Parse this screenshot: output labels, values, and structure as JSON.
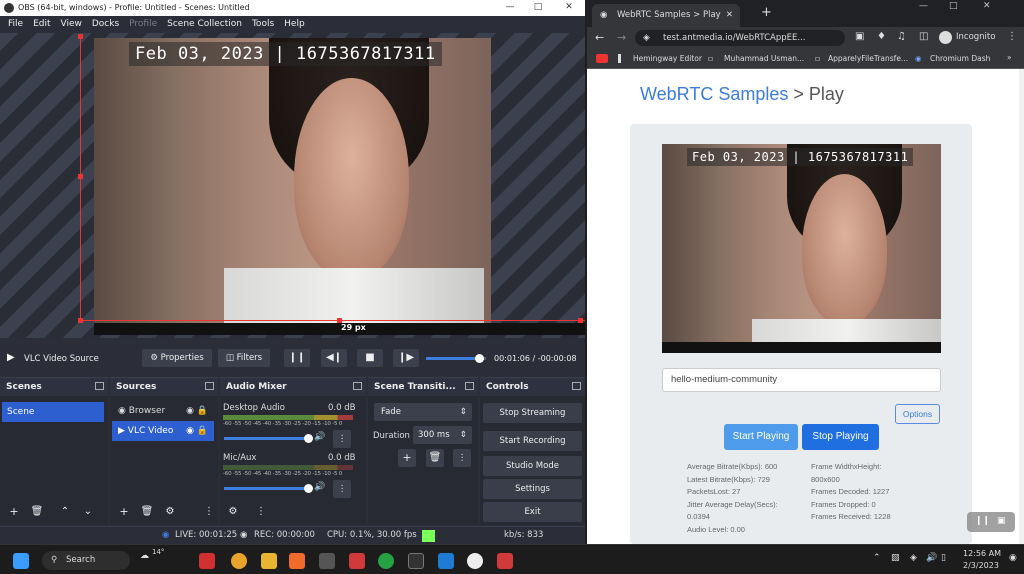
{
  "obs": {
    "title": "OBS  (64-bit, windows) - Profile: Untitled - Scenes: Untitled",
    "menu": [
      {
        "label": "File",
        "disabled": false
      },
      {
        "label": "Edit",
        "disabled": false
      },
      {
        "label": "View",
        "disabled": false
      },
      {
        "label": "Docks",
        "disabled": false
      },
      {
        "label": "Profile",
        "disabled": true
      },
      {
        "label": "Scene Collection",
        "disabled": false
      },
      {
        "label": "Tools",
        "disabled": false
      },
      {
        "label": "Help",
        "disabled": false
      }
    ],
    "preview": {
      "timestamp": "Feb 03, 2023 | 1675367817311",
      "px_label": "29 px"
    },
    "source_bar": {
      "source_name": "VLC Video Source",
      "properties_label": "Properties",
      "filters_label": "Filters",
      "time_current": "00:01:06",
      "time_sep": "/",
      "time_remaining": "-00:00:08",
      "progress": 0.88
    },
    "scenes": {
      "title": "Scenes",
      "items": [
        "Scene"
      ]
    },
    "sources": {
      "title": "Sources",
      "items": [
        "Browser",
        "VLC Video"
      ]
    },
    "audio_mixer": {
      "title": "Audio Mixer",
      "scale": "-60 -55 -50 -45 -40 -35 -30 -25 -20 -15 -10 -5 0",
      "channels": [
        {
          "name": "Desktop Audio",
          "level": "0.0 dB",
          "volume": 1.0
        },
        {
          "name": "Mic/Aux",
          "level": "0.0 dB",
          "volume": 1.0
        }
      ]
    },
    "transitions": {
      "title": "Scene Transiti...",
      "selected": "Fade",
      "duration_label": "Duration",
      "duration_value": "300 ms"
    },
    "controls": {
      "title": "Controls",
      "buttons": [
        "Stop Streaming",
        "Start Recording",
        "Studio Mode",
        "Settings",
        "Exit"
      ]
    },
    "status": {
      "live": "LIVE: 00:01:25",
      "rec": "REC: 00:00:00",
      "cpu": "CPU: 0.1%, 30.00 fps",
      "kbs": "kb/s: 833"
    }
  },
  "chrome": {
    "tab_title": "WebRTC Samples > Play",
    "url": "test.antmedia.io/WebRTCAppEE...",
    "profile_label": "Incognito",
    "bookmarks": [
      "Hemingway Editor",
      "Muhammad Usman...",
      "ApparelyFileTransfe...",
      "Chromium Dash"
    ],
    "page": {
      "heading_brand": "WebRTC Samples",
      "heading_rest": " > Play",
      "timestamp": "Feb 03, 2023 | 1675367817311",
      "stream_id": "hello-medium-community",
      "options_label": "Options",
      "start_label": "Start Playing",
      "stop_label": "Stop Playing",
      "stats_left": [
        "Average Bitrate(Kbps): 600",
        "Latest Bitrate(Kbps): 729",
        "PacketsLost: 27",
        "Jitter Average Delay(Secs):",
        "0.0394",
        "Audio Level: 0.00"
      ],
      "stats_right": [
        "Frame WidthxHeight:",
        "800x600",
        "Frames Decoded: 1227",
        "Frames Dropped: 0",
        "Frames Received: 1228"
      ]
    }
  },
  "taskbar": {
    "search_label": "Search",
    "weather": "14°",
    "time": "12:56 AM",
    "date": "2/3/2023"
  },
  "colors": {
    "obs_bg": "#2b2e38",
    "selection": "#2d5fd0",
    "brand_blue": "#3b7ddd",
    "button_blue": "#4e9bec",
    "stop_blue": "#1f6fe0",
    "live_green": "#7bff5a"
  }
}
